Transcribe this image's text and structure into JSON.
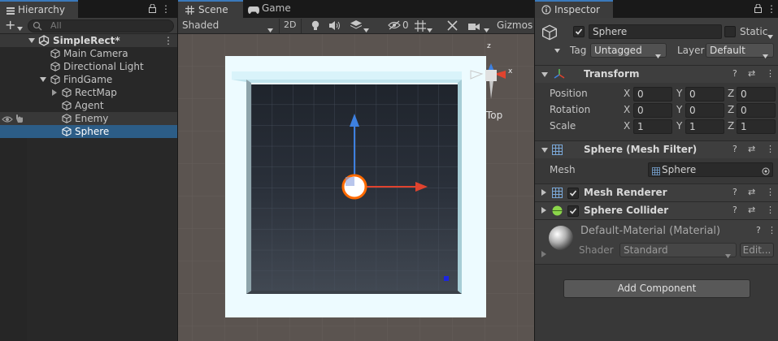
{
  "hierarchy": {
    "tab": "Hierarchy",
    "search_placeholder": "All",
    "add_label": "+",
    "scene_name": "SimpleRect*",
    "items": [
      {
        "label": "Main Camera"
      },
      {
        "label": "Directional Light"
      },
      {
        "label": "FindGame"
      },
      {
        "label": "RectMap"
      },
      {
        "label": "Agent"
      },
      {
        "label": "Enemy"
      },
      {
        "label": "Sphere"
      }
    ]
  },
  "scene": {
    "tabs": [
      {
        "label": "Scene"
      },
      {
        "label": "Game"
      }
    ],
    "shading": "Shaded",
    "mode_2d": "2D",
    "hidden_count": "0",
    "gizmos": "Gizmos",
    "view_label": "Top",
    "gizmo_axes": {
      "z": "z",
      "x": "x"
    }
  },
  "inspector": {
    "tab": "Inspector",
    "object_name": "Sphere",
    "static_label": "Static",
    "tag_label": "Tag",
    "tag_value": "Untagged",
    "layer_label": "Layer",
    "layer_value": "Default",
    "transform": {
      "title": "Transform",
      "rows": [
        {
          "label": "Position",
          "x": "0",
          "y": "0",
          "z": "0"
        },
        {
          "label": "Rotation",
          "x": "0",
          "y": "0",
          "z": "0"
        },
        {
          "label": "Scale",
          "x": "1",
          "y": "1",
          "z": "1"
        }
      ],
      "axis_x": "X",
      "axis_y": "Y",
      "axis_z": "Z"
    },
    "mesh_filter": {
      "title": "Sphere (Mesh Filter)",
      "mesh_label": "Mesh",
      "mesh_value": "Sphere"
    },
    "mesh_renderer": {
      "title": "Mesh Renderer"
    },
    "sphere_collider": {
      "title": "Sphere Collider"
    },
    "material": {
      "name": "Default-Material (Material)",
      "shader_label": "Shader",
      "shader_value": "Standard",
      "edit_label": "Edit..."
    },
    "add_component": "Add Component"
  }
}
